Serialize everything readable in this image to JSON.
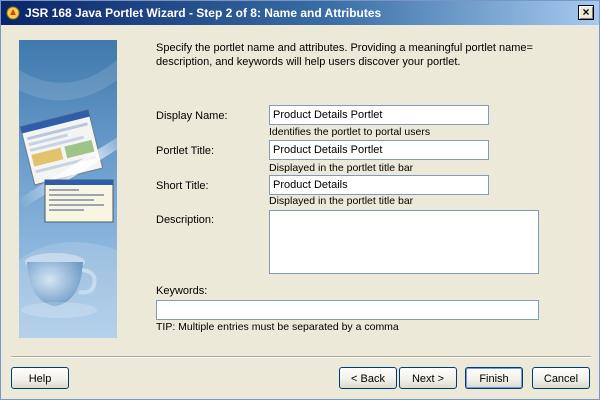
{
  "window": {
    "title": "JSR 168 Java Portlet Wizard - Step 2 of 8: Name and Attributes",
    "close_label": "×"
  },
  "intro": {
    "text": "Specify the portlet name and attributes. Providing a meaningful portlet name= description, and keywords will help users discover your portlet."
  },
  "form": {
    "display_name": {
      "label": "Display Name:",
      "value": "Product Details Portlet",
      "hint": "Identifies the portlet to portal users"
    },
    "portlet_title": {
      "label": "Portlet Title:",
      "value": "Product Details Portlet",
      "hint": "Displayed in the portlet title bar"
    },
    "short_title": {
      "label": "Short Title:",
      "value": "Product Details",
      "hint": "Displayed in the portlet title bar"
    },
    "description": {
      "label": "Description:",
      "value": ""
    },
    "keywords": {
      "label": "Keywords:",
      "value": "",
      "tip": "TIP: Multiple entries must be separated by a comma"
    }
  },
  "buttons": {
    "help": "Help",
    "back": "< Back",
    "next": "Next >",
    "finish": "Finish",
    "cancel": "Cancel"
  },
  "colors": {
    "titlebar_start": "#0a246a",
    "titlebar_end": "#a6caf0",
    "dialog_bg": "#ece9d8",
    "side_panel": "#3f79ad"
  }
}
